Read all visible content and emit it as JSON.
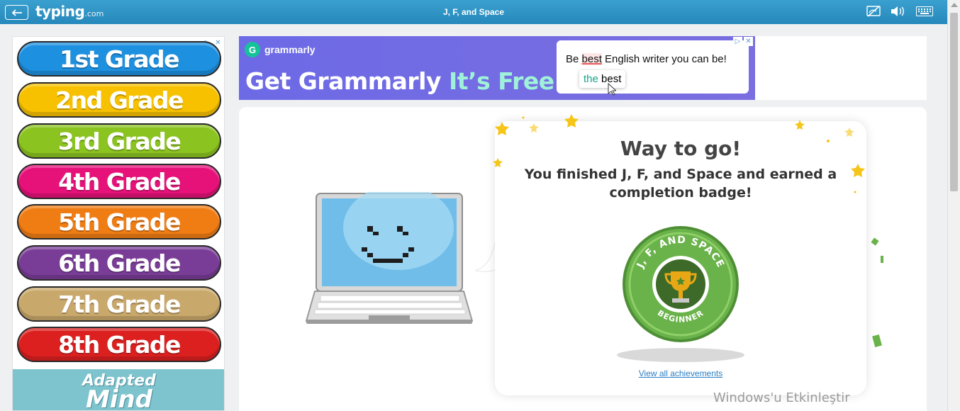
{
  "topbar": {
    "logo_main": "typing",
    "logo_domain": ".com",
    "lesson_title": "J, F, and Space",
    "icons": [
      "back-arrow-icon",
      "visibility-off-icon",
      "volume-icon",
      "keyboard-icon"
    ]
  },
  "left_ad": {
    "grades": [
      "1st Grade",
      "2nd Grade",
      "3rd Grade",
      "4th Grade",
      "5th Grade",
      "6th Grade",
      "7th Grade",
      "8th Grade"
    ],
    "grade_colors": [
      "#1e90e0",
      "#f7c100",
      "#8bc320",
      "#e6127a",
      "#f07d14",
      "#7a3d97",
      "#c9a86b",
      "#dc2020"
    ],
    "brand_line1": "Adapted",
    "brand_line2": "Mind"
  },
  "grammarly_ad": {
    "logo_text": "grammarly",
    "headline": "Get Grammarly",
    "headline_accent": "It’s Free",
    "sentence_before": "Be ",
    "sentence_error": "best",
    "sentence_after": " English writer you can be!",
    "suggest_green": "the",
    "suggest_rest": " best"
  },
  "result": {
    "title": "Way to go!",
    "message": "You finished J, F, and Space and earned a completion badge!",
    "badge_top_text": "J, F, AND SPACE",
    "badge_bottom_text": "BEGINNER",
    "link": "View all achievements"
  },
  "watermark": "Windows'u Etkinleştir",
  "colors": {
    "topbar": "#2f93c6",
    "badge_green": "#6ab24a",
    "link": "#2a7fc4",
    "star": "#f5c518"
  }
}
